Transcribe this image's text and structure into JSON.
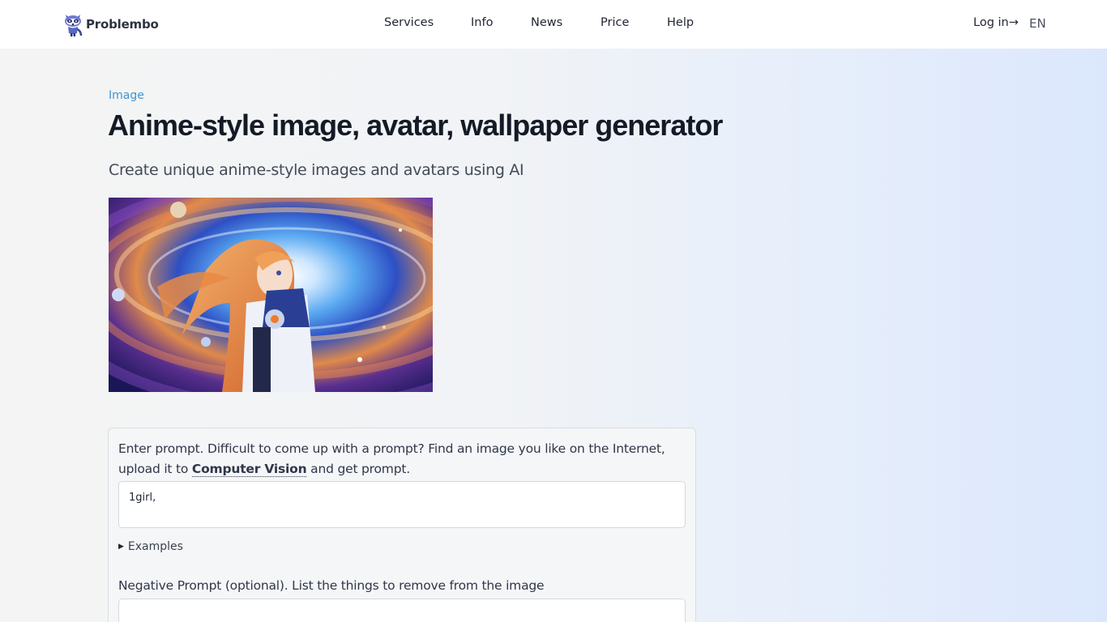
{
  "header": {
    "brand": "Problembo",
    "nav": [
      {
        "label": "Services"
      },
      {
        "label": "Info"
      },
      {
        "label": "News"
      },
      {
        "label": "Price"
      },
      {
        "label": "Help"
      }
    ],
    "login_label": "Log in",
    "language": "EN"
  },
  "main": {
    "breadcrumb": "Image",
    "title": "Anime-style image, avatar, wallpaper generator",
    "subtitle": "Create unique anime-style images and avatars using AI"
  },
  "form": {
    "prompt_label_part1": "Enter prompt. Difficult to come up with a prompt? Find an image you like on the Internet, upload it to ",
    "prompt_label_link": "Computer Vision",
    "prompt_label_part2": " and get prompt.",
    "prompt_value": "1girl,",
    "examples_label": "Examples",
    "negative_label": "Negative Prompt (optional). List the things to remove from the image",
    "negative_value": ""
  },
  "colors": {
    "accent_link": "#3f95d1",
    "title_text": "#141a26",
    "body_text": "#30374a"
  },
  "icons": {
    "logo": "raccoon-mascot-icon",
    "login_arrow": "arrow-right-icon",
    "disclosure": "triangle-right-icon"
  }
}
